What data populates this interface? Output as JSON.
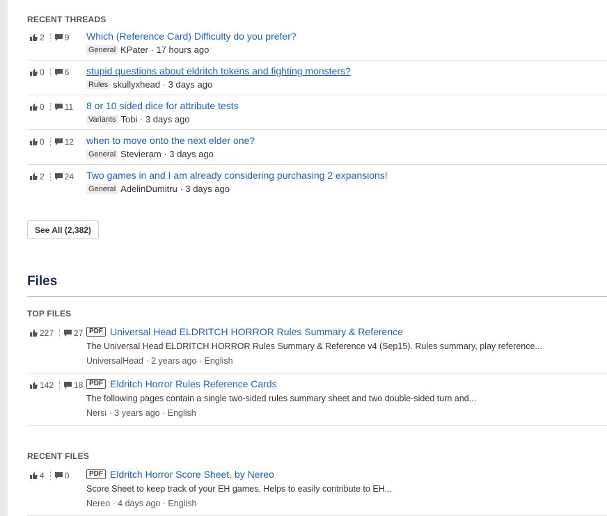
{
  "recent_threads": {
    "heading": "RECENT THREADS",
    "items": [
      {
        "likes": "2",
        "comments": "9",
        "title": "Which (Reference Card) Difficulty do you prefer?",
        "tag": "General",
        "author": "KPater",
        "time": "17 hours ago"
      },
      {
        "likes": "0",
        "comments": "6",
        "title": "stupid questions about eldritch tokens and fighting monsters?",
        "tag": "Rules",
        "author": "skullyxhead",
        "time": "3 days ago"
      },
      {
        "likes": "0",
        "comments": "11",
        "title": "8 or 10 sided dice for attribute tests",
        "tag": "Variants",
        "author": "Tobi",
        "time": "3 days ago"
      },
      {
        "likes": "0",
        "comments": "12",
        "title": "when to move onto the next elder one?",
        "tag": "General",
        "author": "Stevieram",
        "time": "3 days ago"
      },
      {
        "likes": "2",
        "comments": "24",
        "title": "Two games in and I am already considering purchasing 2 expansions!",
        "tag": "General",
        "author": "AdelinDumitru",
        "time": "3 days ago"
      }
    ],
    "see_all": "See All (2,382)"
  },
  "files": {
    "heading": "Files",
    "top_files": {
      "heading": "TOP FILES",
      "items": [
        {
          "likes": "227",
          "comments": "27",
          "format": "PDF",
          "title": "Universal Head ELDRITCH HORROR Rules Summary & Reference",
          "description": "The Universal Head ELDRITCH HORROR Rules Summary & Reference v4 (Sep15). Rules summary, play reference...",
          "meta": "UniversalHead · 2 years ago · English"
        },
        {
          "likes": "142",
          "comments": "18",
          "format": "PDF",
          "title": "Eldritch Horror Rules Reference Cards",
          "description": "The following pages contain a single two-sided rules summary sheet and two double-sided turn and...",
          "meta": "Nersi · 3 years ago · English"
        }
      ]
    },
    "recent_files": {
      "heading": "RECENT FILES",
      "items": [
        {
          "likes": "4",
          "comments": "0",
          "format": "PDF",
          "title": "Eldritch Horror Score Sheet, by Nereo",
          "description": "Score Sheet to keep track of your EH games. Helps to easily contribute to EH...",
          "meta": "Nereo · 4 days ago · English"
        }
      ]
    }
  },
  "icons": {
    "like": "thumbs-up-icon",
    "comment": "comment-bubble-icon"
  },
  "colors": {
    "link": "#1f5fbf",
    "heading": "#1e2b4f",
    "divider": "#dddddd"
  }
}
